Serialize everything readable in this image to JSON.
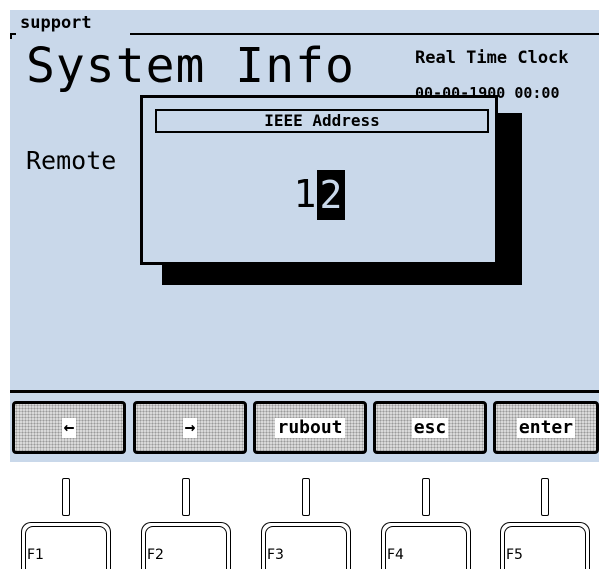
{
  "section": {
    "title": "support"
  },
  "page": {
    "title": "System Info"
  },
  "clock": {
    "label": "Real Time Clock",
    "value": "00-00-1900 00:00"
  },
  "remote": {
    "label": "Remote"
  },
  "dialog": {
    "title": "IEEE Address",
    "value_digit": "1",
    "cursor_digit": "2"
  },
  "softkeys": [
    {
      "label": "←"
    },
    {
      "label": "→"
    },
    {
      "label": "rubout"
    },
    {
      "label": "esc"
    },
    {
      "label": "enter"
    }
  ],
  "function_keys": [
    {
      "label": "F1"
    },
    {
      "label": "F2"
    },
    {
      "label": "F3"
    },
    {
      "label": "F4"
    },
    {
      "label": "F5"
    }
  ],
  "colors": {
    "screen_background": "#c9d8ea",
    "softkey_face": "#d9d9d9",
    "text": "#000000"
  }
}
